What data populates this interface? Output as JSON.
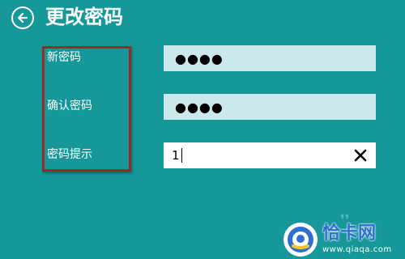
{
  "header": {
    "back_icon": "back-arrow-circle-icon",
    "title": "更改密码"
  },
  "form": {
    "new_password": {
      "label": "新密码",
      "value_masked": "●●●●"
    },
    "confirm_password": {
      "label": "确认密码",
      "value_masked": "●●●●"
    },
    "password_hint": {
      "label": "密码提示",
      "value": "1",
      "clear_icon": "close-x-icon"
    }
  },
  "watermark": {
    "name": "恰卡网",
    "url": "www.qiaqa.com"
  },
  "colors": {
    "background": "#169799",
    "field_bg": "#cbe9ea",
    "active_field_bg": "#ffffff",
    "highlight_border": "#9a2a2a",
    "text": "#ffffff"
  }
}
